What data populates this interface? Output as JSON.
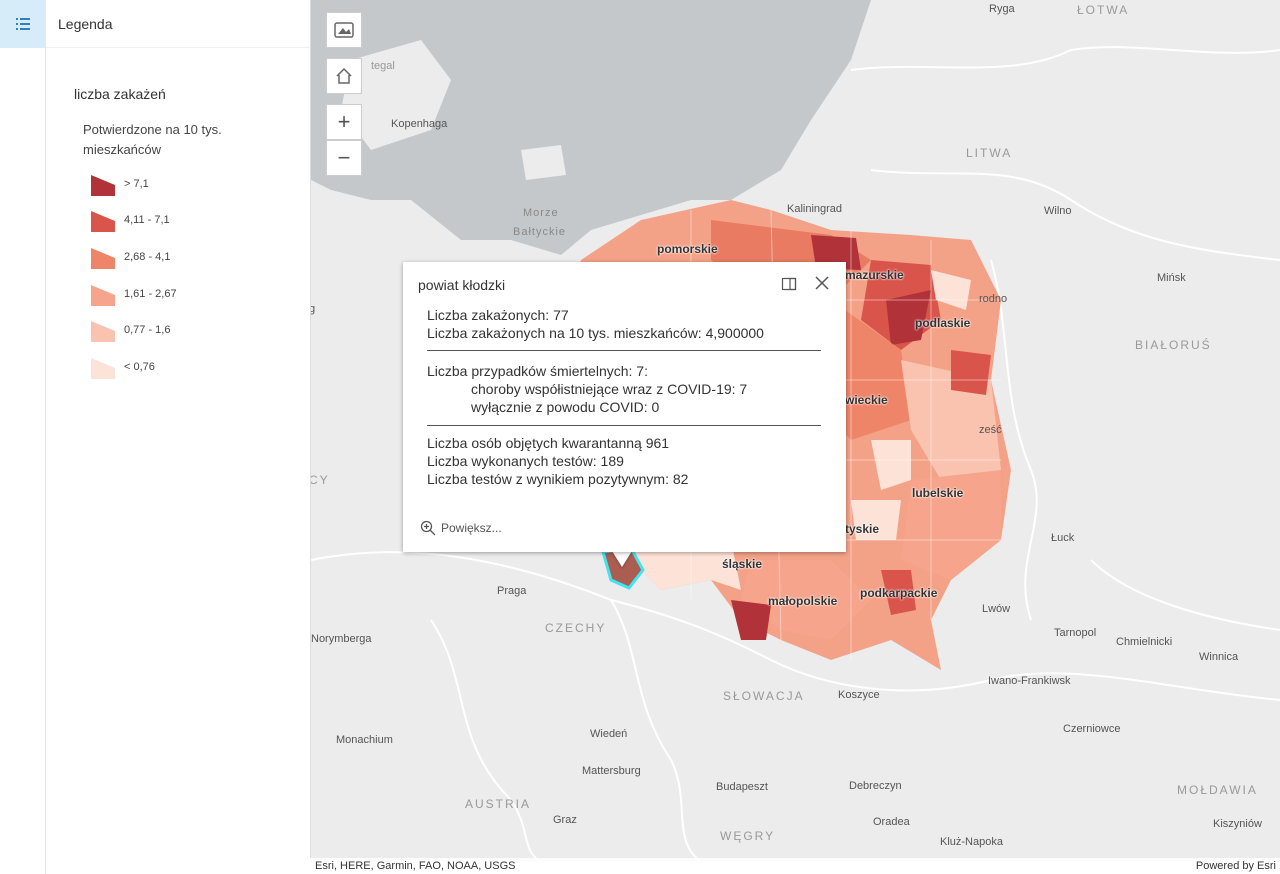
{
  "legend": {
    "header": "Legenda",
    "layer_title": "liczba zakażeń",
    "field": "Potwierdzone na 10 tys. mieszkańców",
    "classes": [
      {
        "label": "> 7,1",
        "color": "#b2323a"
      },
      {
        "label": "4,11 - 7,1",
        "color": "#d9544b"
      },
      {
        "label": "2,68 - 4,1",
        "color": "#ee8468"
      },
      {
        "label": "1,61 - 2,67",
        "color": "#f6a48b"
      },
      {
        "label": "0,77 - 1,6",
        "color": "#fac3b0"
      },
      {
        "label": "< 0,76",
        "color": "#fde2d8"
      }
    ]
  },
  "map": {
    "labels": {
      "ryga": "Ryga",
      "lotwa": "ŁOTWA",
      "kopenhaga": "Kopenhaga",
      "litwa": "LITWA",
      "morze1": "Morze",
      "morze2": "Bałtyckie",
      "kaliningrad": "Kaliningrad",
      "wilno": "Wilno",
      "minsk": "Mińsk",
      "bialorus": "BIAŁORUŚ",
      "grodno": "rodno",
      "pomorskie": "pomorskie",
      "mazurskie": "mazurskie",
      "podlaskie": "podlaskie",
      "wieckie": "wieckie",
      "lubelskie": "lubelskie",
      "tyskie": "tyskie",
      "slaskie": "śląskie",
      "malopolskie": "małopolskie",
      "podkarpackie": "podkarpackie",
      "praga": "Praga",
      "czechy": "CZECHY",
      "norymberga": "Norymberga",
      "luck": "Łuck",
      "lwow": "Lwów",
      "tarnopol": "Tarnopol",
      "chmielnicki": "Chmielnicki",
      "winnica": "Winnica",
      "iwano": "Iwano-Frankiwsk",
      "slowacja": "SŁOWACJA",
      "koszyce": "Koszyce",
      "monachium": "Monachium",
      "wieden": "Wiedeń",
      "mattersburg": "Mattersburg",
      "budapeszt": "Budapeszt",
      "debreczyn": "Debreczyn",
      "czerniowce": "Czerniowce",
      "austria": "AUSTRIA",
      "graz": "Graz",
      "oradea": "Oradea",
      "wegry": "WĘGRY",
      "kluz": "Kluż-Napoka",
      "moldawia": "MOŁDAWIA",
      "kiszyniow": "Kiszyniów",
      "cy": "CY",
      "g": "g",
      "egal": "tegal",
      "zesc": "ześć"
    }
  },
  "popup": {
    "title": "powiat kłodzki",
    "cases": "Liczba zakażonych: 77",
    "cases_per": "Liczba zakażonych na 10 tys. mieszkańców: 4,900000",
    "deaths": "Liczba przypadków śmiertelnych: 7:",
    "deaths_comorb": "choroby współistniejące wraz z COVID-19: 7",
    "deaths_covid": "wyłącznie z powodu COVID: 0",
    "quarantine": "Liczba osób objętych kwarantanną 961",
    "tests": "Liczba wykonanych testów: 189",
    "positive": "Liczba testów z wynikiem pozytywnym: 82",
    "zoom": "Powiększ..."
  },
  "attribution": {
    "left": "Esri, HERE, Garmin, FAO, NOAA, USGS",
    "right": "Powered by Esri"
  }
}
